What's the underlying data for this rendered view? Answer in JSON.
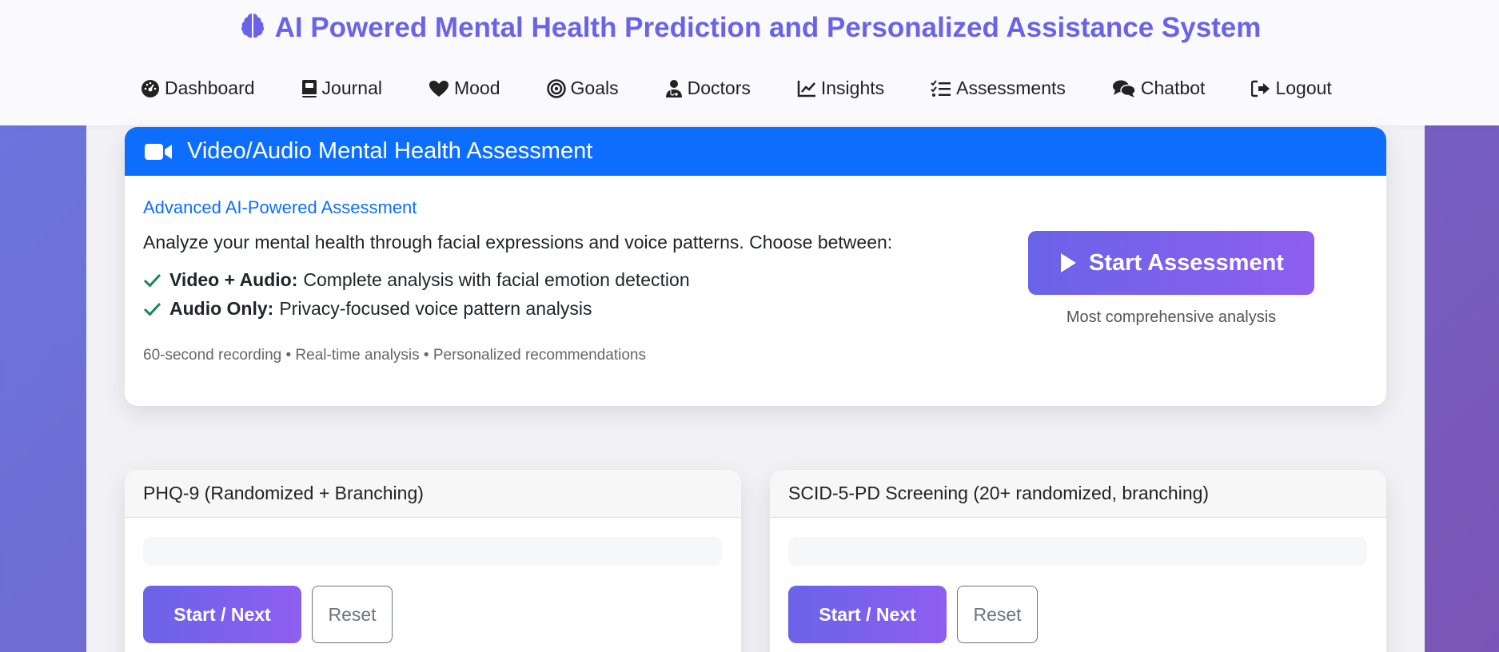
{
  "app": {
    "title": "AI Powered Mental Health Prediction and Personalized Assistance System",
    "brand_color": "#6a63e8",
    "logo_icon": "brain-icon"
  },
  "nav": {
    "items": [
      {
        "label": "Dashboard",
        "icon": "gauge-icon"
      },
      {
        "label": "Journal",
        "icon": "journal-icon"
      },
      {
        "label": "Mood",
        "icon": "heart-icon"
      },
      {
        "label": "Goals",
        "icon": "target-icon"
      },
      {
        "label": "Doctors",
        "icon": "doctor-icon"
      },
      {
        "label": "Insights",
        "icon": "chart-line-icon"
      },
      {
        "label": "Assessments",
        "icon": "list-check-icon"
      },
      {
        "label": "Chatbot",
        "icon": "comments-icon"
      },
      {
        "label": "Logout",
        "icon": "logout-icon"
      }
    ]
  },
  "video_assessment": {
    "header_title": "Video/Audio Mental Health Assessment",
    "header_color": "#0d6efd",
    "subtitle": "Advanced AI-Powered Assessment",
    "description": "Analyze your mental health through facial expressions and voice patterns. Choose between:",
    "features": [
      {
        "title": "Video + Audio:",
        "text": "Complete analysis with facial emotion detection"
      },
      {
        "title": "Audio Only:",
        "text": "Privacy-focused voice pattern analysis"
      }
    ],
    "meta": "60-second recording • Real-time analysis • Personalized recommendations",
    "start_button": "Start Assessment",
    "start_hint": "Most comprehensive analysis"
  },
  "questionnaires": [
    {
      "title": "PHQ-9 (Randomized + Branching)",
      "start_label": "Start / Next",
      "reset_label": "Reset"
    },
    {
      "title": "SCID-5-PD Screening (20+ randomized, branching)",
      "start_label": "Start / Next",
      "reset_label": "Reset"
    }
  ]
}
